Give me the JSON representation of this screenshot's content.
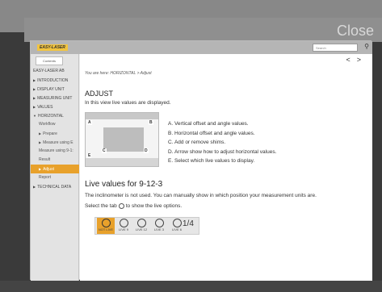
{
  "window": {
    "close_label": "Close"
  },
  "header": {
    "logo": "EASY-LASER",
    "search_placeholder": "Search"
  },
  "sidebar": {
    "tab_label": "Contents",
    "items": [
      {
        "label": "EASY-LASER AB",
        "level": 0
      },
      {
        "label": "INTRODUCTION",
        "level": 0
      },
      {
        "label": "DISPLAY UNIT",
        "level": 0
      },
      {
        "label": "MEASURING UNIT",
        "level": 0
      },
      {
        "label": "VALUES",
        "level": 0
      },
      {
        "label": "HORIZONTAL",
        "level": 0
      },
      {
        "label": "Workflow",
        "level": 1
      },
      {
        "label": "Prepare",
        "level": 1
      },
      {
        "label": "Measure using E",
        "level": 1
      },
      {
        "label": "Measure using 9-1:",
        "level": 1
      },
      {
        "label": "Result",
        "level": 1
      },
      {
        "label": "Adjust",
        "level": 1
      },
      {
        "label": "Report",
        "level": 1
      },
      {
        "label": "TECHNICAL DATA",
        "level": 0
      }
    ]
  },
  "content": {
    "nav_prev": "<",
    "nav_next": ">",
    "breadcrumb": "You are here: HORIZONTAL > Adjust",
    "title": "ADJUST",
    "intro": "In this view live values are displayed.",
    "image_labels": [
      "A",
      "B",
      "C",
      "D",
      "E"
    ],
    "legend": [
      "A.  Vertical offset and angle values.",
      "B.  Horizontal offset and angle values.",
      "C.  Add or remove shims.",
      "D.  Arrow show how to adjust horizontal values.",
      "E.  Select which live values to display."
    ],
    "section_title": "Live values for 9-12-3",
    "para1": "The inclinometer is not used. You can manually show in which position your measurement units are.",
    "para2_before": "Select the tab",
    "para2_after": "to show the live options.",
    "tabs": [
      "NOT LIVE",
      "LIVE 9",
      "LIVE 12",
      "LIVE 3",
      "LIVE 6"
    ],
    "tab_last": "1/4"
  }
}
